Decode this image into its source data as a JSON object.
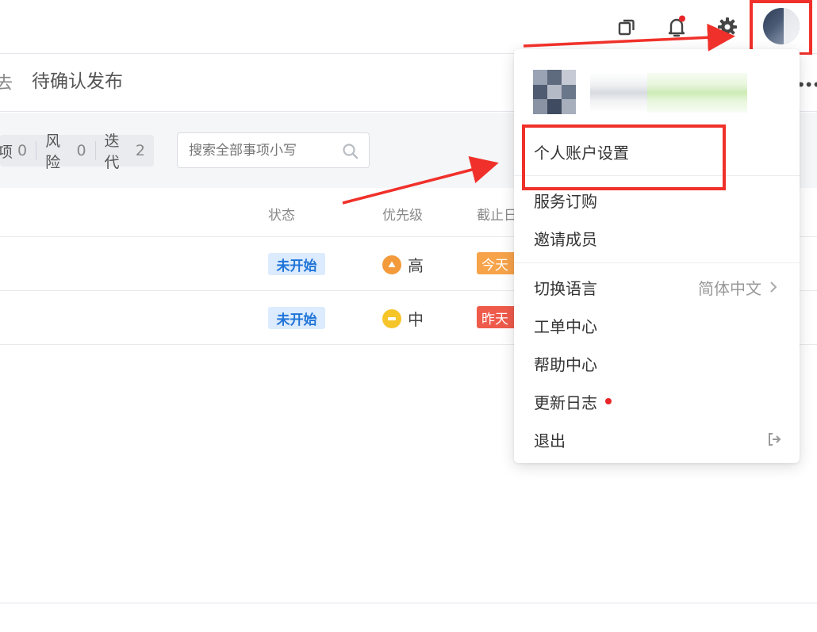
{
  "colors": {
    "accent_red": "#f0302a",
    "status_blue": "#1f74d8",
    "status_bg": "#dcebfd",
    "priority_high": "#f39a3a",
    "priority_mid": "#f6c52a",
    "due_today": "#f7a34a",
    "due_overdue": "#ef5b4b"
  },
  "topbar": {
    "icons": [
      "copy-icon",
      "bell-icon",
      "gear-icon",
      "avatar"
    ]
  },
  "subheader": {
    "trail_char": "去",
    "title": "待确认发布"
  },
  "filters": [
    {
      "label": "项",
      "count": "0"
    },
    {
      "label": "风险",
      "count": "0"
    },
    {
      "label": "迭代",
      "count": "2"
    }
  ],
  "search": {
    "placeholder": "搜索全部事项小写"
  },
  "table": {
    "columns": [
      "状态",
      "优先级",
      "截止日"
    ],
    "rows": [
      {
        "status": "未开始",
        "priority": "高",
        "priority_level": "high",
        "due": "今天"
      },
      {
        "status": "未开始",
        "priority": "中",
        "priority_level": "medium",
        "due": "昨天"
      }
    ]
  },
  "dropdown": {
    "items": {
      "account_settings": "个人账户设置",
      "subscription": "服务订购",
      "invite": "邀请成员",
      "language": "切换语言",
      "language_value": "简体中文",
      "tickets": "工单中心",
      "help": "帮助中心",
      "changelog": "更新日志",
      "logout": "退出"
    }
  }
}
